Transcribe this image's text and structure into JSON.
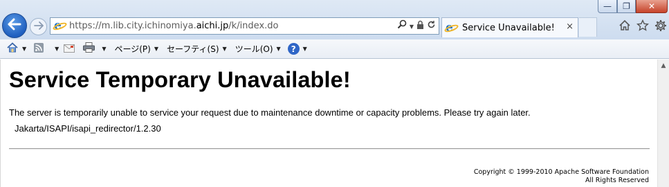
{
  "browser": {
    "url_prefix": "https://m.lib.city.ichinomiya.",
    "url_domain": "aichi.jp",
    "url_suffix": "/k/index.do",
    "tab_title": "Service Unavailable!",
    "tab_close": "×",
    "icons": {
      "back": "back-arrow-icon",
      "forward": "forward-arrow-icon",
      "search": "search-icon",
      "lock": "lock-icon",
      "refresh": "refresh-icon",
      "home": "home-icon",
      "favorites": "star-icon",
      "settings": "gear-icon"
    }
  },
  "command_bar": {
    "page_label": "ページ(P)",
    "safety_label": "セーフティ(S)",
    "tools_label": "ツール(O)"
  },
  "page": {
    "heading": "Service Temporary Unavailable!",
    "message": "The server is temporarily unable to service your request due to maintenance downtime or capacity problems. Please try again later.",
    "server_signature": "Jakarta/ISAPI/isapi_redirector/1.2.30",
    "footer_line1": "Copyright © 1999-2010 Apache Software Foundation",
    "footer_line2": "All Rights Reserved"
  },
  "colors": {
    "chrome_bg": "#d6e3f3",
    "back_button": "#2d6fd0",
    "help_icon": "#2f66c7",
    "close_button": "#c6432a"
  }
}
